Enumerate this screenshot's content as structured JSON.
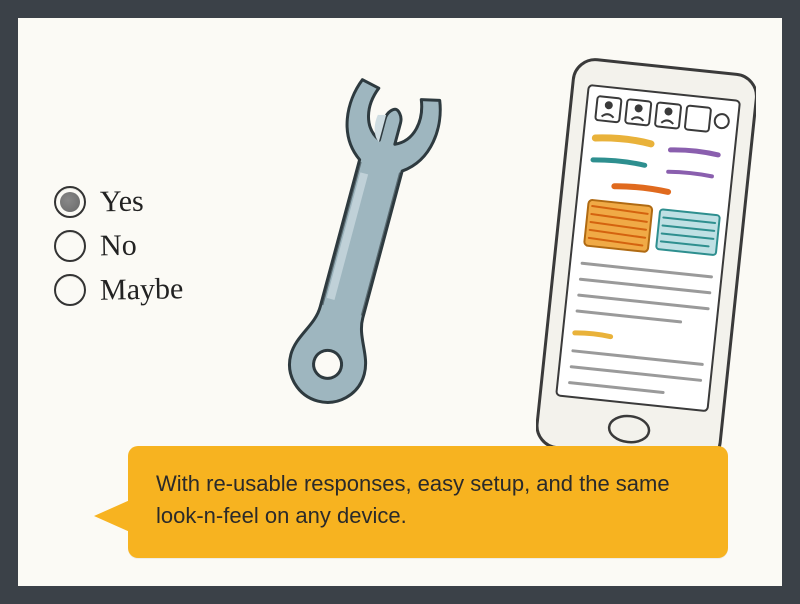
{
  "radios": {
    "options": [
      {
        "label": "Yes",
        "selected": true
      },
      {
        "label": "No",
        "selected": false
      },
      {
        "label": "Maybe",
        "selected": false
      }
    ]
  },
  "speech": {
    "text": "With re-usable responses, easy setup, and the same look-n-feel on any device."
  },
  "illustrations": {
    "wrench_name": "wrench-icon",
    "phone_name": "phone-mockup-icon"
  },
  "colors": {
    "frame": "#3b4148",
    "canvas": "#fbfaf5",
    "bubble": "#f7b320",
    "ink": "#2a2a2a",
    "wrench_fill": "#9eb6bf",
    "accent_orange": "#e88a2a",
    "accent_purple": "#8a5fae",
    "accent_teal": "#2e8f8f"
  }
}
